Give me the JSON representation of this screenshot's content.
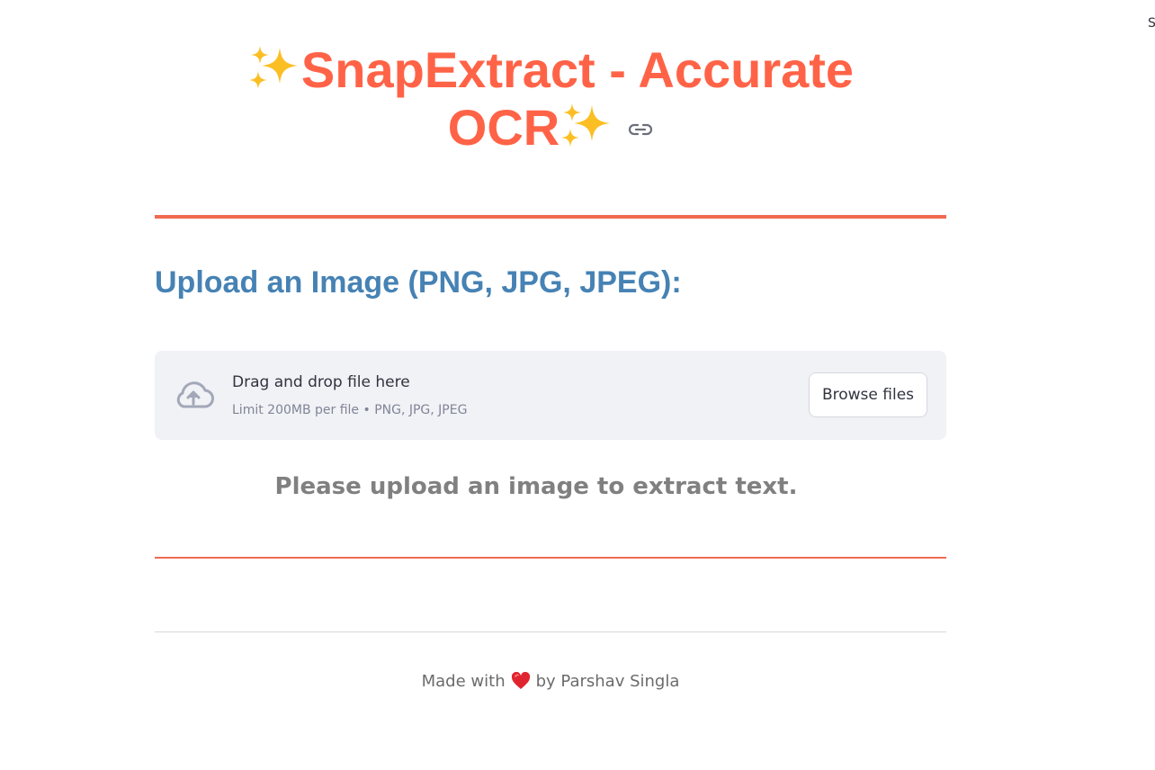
{
  "corner": {
    "text": "S"
  },
  "header": {
    "title_line1": "SnapExtract - Accurate",
    "title_line2": "OCR",
    "title_color": "#ff6347",
    "sparkle_icon": "sparkles-icon",
    "anchor_icon": "link-icon"
  },
  "upload": {
    "heading": "Upload an Image (PNG, JPG, JPEG):",
    "heading_color": "#4682b4",
    "dropzone_title": "Drag and drop file here",
    "dropzone_limit": "Limit 200MB per file • PNG, JPG, JPEG",
    "browse_label": "Browse files",
    "upload_icon": "cloud-upload-icon"
  },
  "status": {
    "message": "Please upload an image to extract text."
  },
  "footer": {
    "prefix": "Made with",
    "suffix": "by Parshav Singla",
    "heart_icon": "heart-icon"
  },
  "colors": {
    "accent": "#f16a50",
    "dropzone_bg": "#f0f2f6"
  }
}
